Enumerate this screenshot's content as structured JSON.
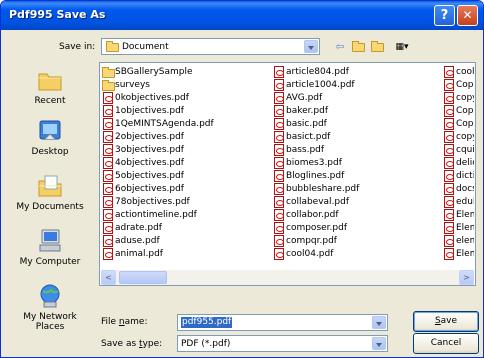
{
  "window": {
    "title": "Pdf995 Save As",
    "help_label": "?",
    "close_label": "✕"
  },
  "toolbar": {
    "save_in_label": "Save in:",
    "save_in_value": "Document",
    "icons": [
      "back-arrow-icon",
      "up-folder-icon",
      "new-folder-icon",
      "views-menu-icon"
    ]
  },
  "places": [
    {
      "label": "Recent",
      "icon": "recent-folder-icon"
    },
    {
      "label": "Desktop",
      "icon": "desktop-icon"
    },
    {
      "label": "My Documents",
      "icon": "my-documents-icon"
    },
    {
      "label": "My Computer",
      "icon": "my-computer-icon"
    },
    {
      "label": "My Network Places",
      "icon": "network-places-icon"
    }
  ],
  "files": {
    "col1": [
      {
        "name": "SBGallerySample",
        "type": "folder"
      },
      {
        "name": "surveys",
        "type": "folder"
      },
      {
        "name": "0kobjectives.pdf",
        "type": "pdf"
      },
      {
        "name": "1objectives.pdf",
        "type": "pdf"
      },
      {
        "name": "1QeMINTSAgenda.pdf",
        "type": "pdf"
      },
      {
        "name": "2objectives.pdf",
        "type": "pdf"
      },
      {
        "name": "3objectives.pdf",
        "type": "pdf"
      },
      {
        "name": "4objectives.pdf",
        "type": "pdf"
      },
      {
        "name": "5objectives.pdf",
        "type": "pdf"
      },
      {
        "name": "6objectives.pdf",
        "type": "pdf"
      },
      {
        "name": "78objectives.pdf",
        "type": "pdf"
      },
      {
        "name": "actiontimeline.pdf",
        "type": "pdf"
      },
      {
        "name": "adrate.pdf",
        "type": "pdf"
      },
      {
        "name": "aduse.pdf",
        "type": "pdf"
      },
      {
        "name": "animal.pdf",
        "type": "pdf"
      }
    ],
    "col2": [
      {
        "name": "article804.pdf",
        "type": "pdf"
      },
      {
        "name": "article1004.pdf",
        "type": "pdf"
      },
      {
        "name": "AVG.pdf",
        "type": "pdf"
      },
      {
        "name": "baker.pdf",
        "type": "pdf"
      },
      {
        "name": "basic.pdf",
        "type": "pdf"
      },
      {
        "name": "basict.pdf",
        "type": "pdf"
      },
      {
        "name": "bass.pdf",
        "type": "pdf"
      },
      {
        "name": "biomes3.pdf",
        "type": "pdf"
      },
      {
        "name": "Bloglines.pdf",
        "type": "pdf"
      },
      {
        "name": "bubbleshare.pdf",
        "type": "pdf"
      },
      {
        "name": "collabeval.pdf",
        "type": "pdf"
      },
      {
        "name": "collabor.pdf",
        "type": "pdf"
      },
      {
        "name": "composer.pdf",
        "type": "pdf"
      },
      {
        "name": "compqr.pdf",
        "type": "pdf"
      },
      {
        "name": "cool04.pdf",
        "type": "pdf"
      }
    ],
    "col3": [
      {
        "name": "cool.",
        "type": "pdf"
      },
      {
        "name": "Copy",
        "type": "pdf"
      },
      {
        "name": "copy",
        "type": "pdf"
      },
      {
        "name": "Copy",
        "type": "pdf"
      },
      {
        "name": "Copy",
        "type": "pdf"
      },
      {
        "name": "copy",
        "type": "pdf"
      },
      {
        "name": "cquic",
        "type": "pdf"
      },
      {
        "name": "delici",
        "type": "pdf"
      },
      {
        "name": "dictic",
        "type": "pdf"
      },
      {
        "name": "docs",
        "type": "pdf"
      },
      {
        "name": "edub",
        "type": "pdf"
      },
      {
        "name": "Elem",
        "type": "pdf"
      },
      {
        "name": "Elem",
        "type": "pdf"
      },
      {
        "name": "elem",
        "type": "pdf"
      },
      {
        "name": "Elem",
        "type": "pdf"
      }
    ]
  },
  "scrollbar": {
    "left_arrow": "<",
    "right_arrow": ">"
  },
  "form": {
    "file_name_label_pre": "File ",
    "file_name_label_ul": "n",
    "file_name_label_post": "ame:",
    "file_name_value": "pdf955.pdf",
    "save_type_label_pre": "Save as ",
    "save_type_label_ul": "t",
    "save_type_label_post": "ype:",
    "save_type_value": "PDF (*.pdf)"
  },
  "buttons": {
    "save_ul": "S",
    "save_rest": "ave",
    "cancel": "Cancel"
  }
}
